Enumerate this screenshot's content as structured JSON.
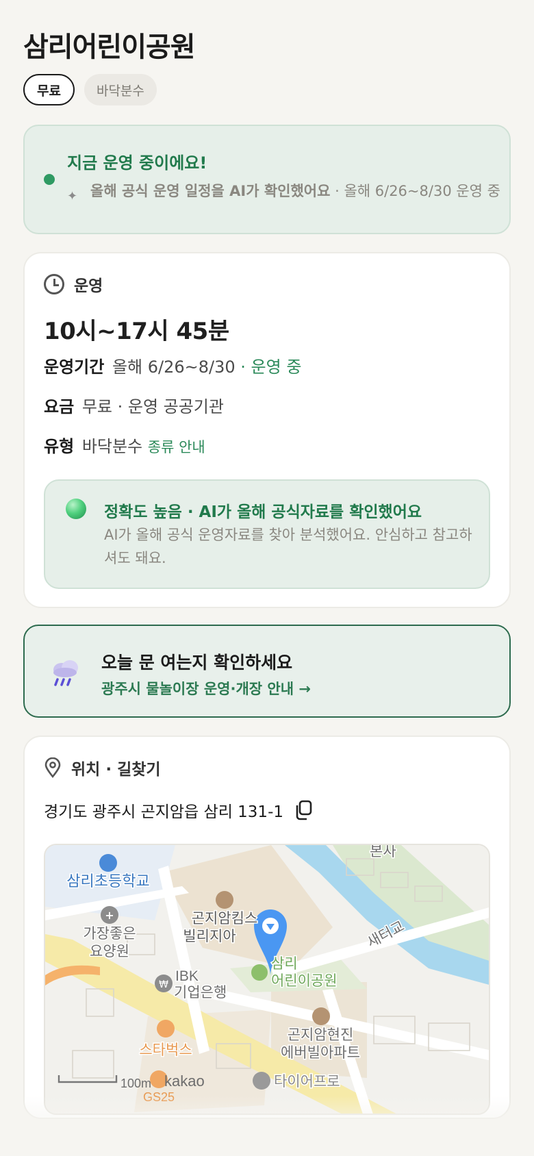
{
  "title": "삼리어린이공원",
  "chips": {
    "fee": "무료",
    "type": "바닥분수"
  },
  "status": {
    "heading": "지금 운영 중이에요!",
    "sub_bold": "올해 공식 운영 일정을 AI가 확인했어요",
    "sub_rest": " · 올해 6/26~8/30 운영 중"
  },
  "hours_card": {
    "section": "운영",
    "hours": "10시~17시 45분",
    "period_label": "운영기간",
    "period_value": "올해 6/26~8/30",
    "period_status": " · 운영 중",
    "fee_label": "요금",
    "fee_value": "무료 · 운영 공공기관",
    "type_label": "유형",
    "type_value": "바닥분수",
    "type_link": "종류 안내",
    "accuracy": {
      "heading": "정확도 높음 · AI가 올해 공식자료를 확인했어요",
      "body": "AI가 올해 공식 운영자료를 찾아 분석했어요. 안심하고 참고하셔도 돼요."
    }
  },
  "notice": {
    "heading": "오늘 문 여는지 확인하세요",
    "link": "광주시 물놀이장 운영·개장 안내 →"
  },
  "location": {
    "section": "위치 · 길찾기",
    "address": "경기도 광주시 곤지암읍 삼리 131-1",
    "map_labels": {
      "school": "삼리초등학교",
      "hospital_1": "가장좋은",
      "hospital_2": "요양원",
      "apt1_1": "곤지암킴스",
      "apt1_2": "빌리지아",
      "bank_1": "IBK",
      "bank_2": "기업은행",
      "park_1": "삼리",
      "park_2": "어린이공원",
      "bridge": "새터교",
      "top": "본사",
      "apt2_1": "곤지암현진",
      "apt2_2": "에버빌아파트",
      "cafe": "스타벅스",
      "scale": "100m",
      "kakao": "kakao",
      "gs": "GS25",
      "tire": "타이어프로"
    }
  },
  "colors": {
    "accent": "#2c8a5a",
    "background": "#f6f5f1"
  }
}
